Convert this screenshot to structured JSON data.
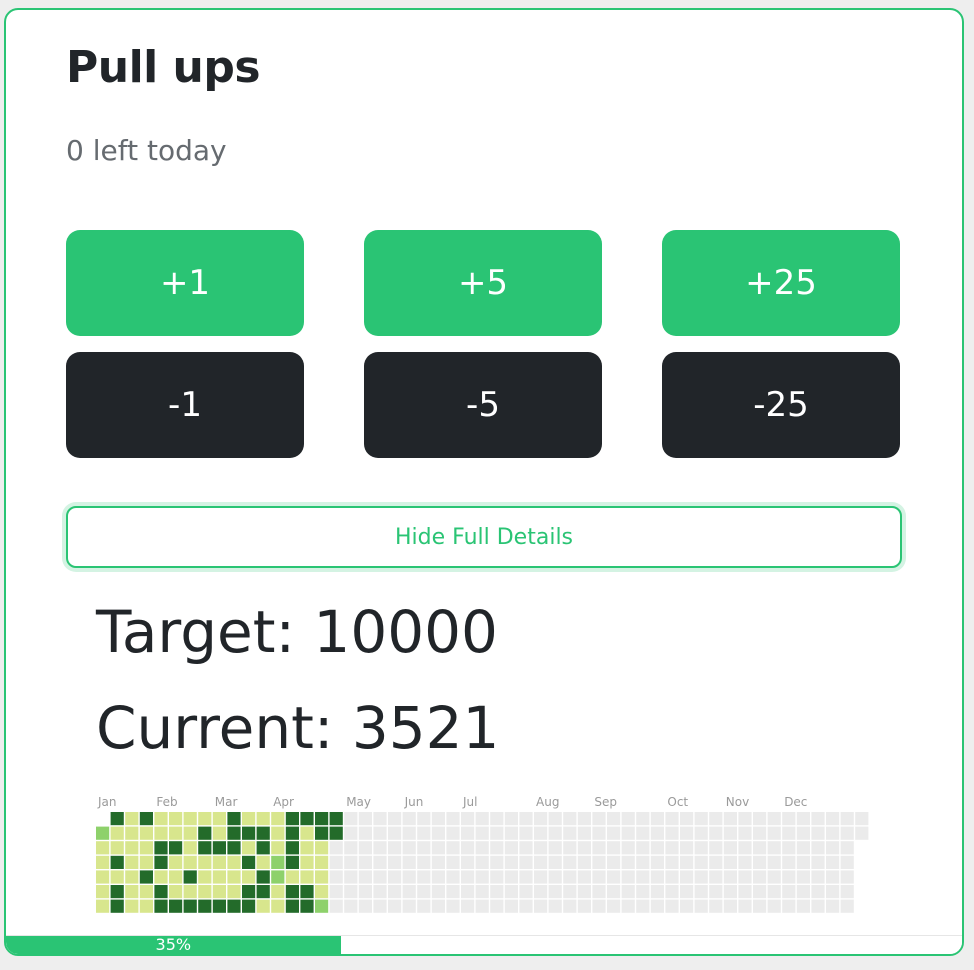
{
  "title": "Pull ups",
  "remaining": "0 left today",
  "increment_buttons": [
    "+1",
    "+5",
    "+25"
  ],
  "decrement_buttons": [
    "-1",
    "-5",
    "-25"
  ],
  "toggle_label": "Hide Full Details",
  "target_text": "Target: 10000",
  "current_text": "Current: 3521",
  "progress": {
    "percent": 35,
    "label": "35%"
  },
  "heatmap": {
    "months": [
      "Jan",
      "Feb",
      "Mar",
      "Apr",
      "May",
      "Jun",
      "Jul",
      "Aug",
      "Sep",
      "Oct",
      "Nov",
      "Dec"
    ],
    "levels": [
      [
        1,
        2,
        1,
        1,
        1,
        1,
        1
      ],
      [
        3,
        1,
        1,
        3,
        1,
        3,
        3
      ],
      [
        1,
        1,
        1,
        1,
        1,
        1,
        1
      ],
      [
        3,
        1,
        1,
        1,
        3,
        1,
        1
      ],
      [
        1,
        1,
        3,
        3,
        1,
        3,
        3
      ],
      [
        1,
        1,
        3,
        1,
        1,
        1,
        3
      ],
      [
        1,
        1,
        1,
        1,
        3,
        1,
        3
      ],
      [
        1,
        3,
        3,
        1,
        1,
        1,
        3
      ],
      [
        1,
        1,
        3,
        1,
        1,
        1,
        3
      ],
      [
        3,
        3,
        3,
        1,
        1,
        1,
        3
      ],
      [
        1,
        3,
        1,
        3,
        1,
        3,
        3
      ],
      [
        1,
        3,
        3,
        1,
        3,
        3,
        1
      ],
      [
        1,
        1,
        1,
        2,
        2,
        1,
        1
      ],
      [
        3,
        3,
        3,
        3,
        1,
        3,
        3
      ],
      [
        3,
        1,
        1,
        1,
        1,
        3,
        3
      ],
      [
        3,
        3,
        1,
        1,
        1,
        1,
        2
      ],
      [
        3,
        3,
        0,
        0,
        0,
        0,
        0
      ]
    ]
  },
  "colors": {
    "accent": "#2ac474",
    "dark": "#212529",
    "heat_empty": "#ebebeb",
    "heat_light": "#d8e68d",
    "heat_mid": "#8ed16b",
    "heat_dark": "#236b2a"
  }
}
